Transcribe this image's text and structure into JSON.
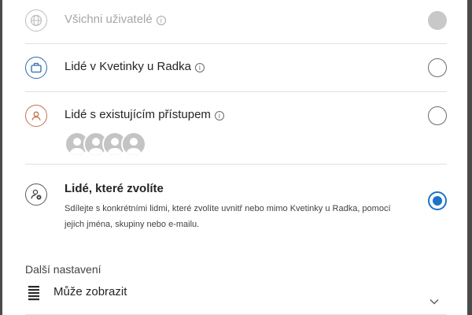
{
  "options": {
    "all_users": {
      "label": "Všichni uživatelé",
      "info_glyph": "i",
      "state": "disabled"
    },
    "org_users": {
      "label": "Lidé v Kvetinky u Radka",
      "info_glyph": "i",
      "state": "unselected"
    },
    "existing_access": {
      "label": "Lidé s existujícím přístupem",
      "info_glyph": "i",
      "state": "unselected",
      "avatar_count": 4
    },
    "specific_people": {
      "label": "Lidé, které zvolíte",
      "description": "Sdílejte s konkrétními lidmi, které zvolíte uvnitř nebo mimo Kvetinky u Radka, pomocí jejich jména, skupiny nebo e-mailu.",
      "state": "selected"
    }
  },
  "settings": {
    "heading": "Další nastavení",
    "permission": {
      "label": "Může zobrazit",
      "icon": "document-lines-icon"
    }
  },
  "colors": {
    "accent": "#1a73c9",
    "org_icon": "#2b6cb0",
    "existing_icon": "#c2724c",
    "disabled_text": "#a6a6a6"
  },
  "icons": {
    "all_users": "globe-icon",
    "org_users": "briefcase-icon",
    "existing_access": "person-icon",
    "specific_people": "people-settings-icon",
    "info": "info-icon",
    "dropdown": "chevron-down-icon"
  }
}
